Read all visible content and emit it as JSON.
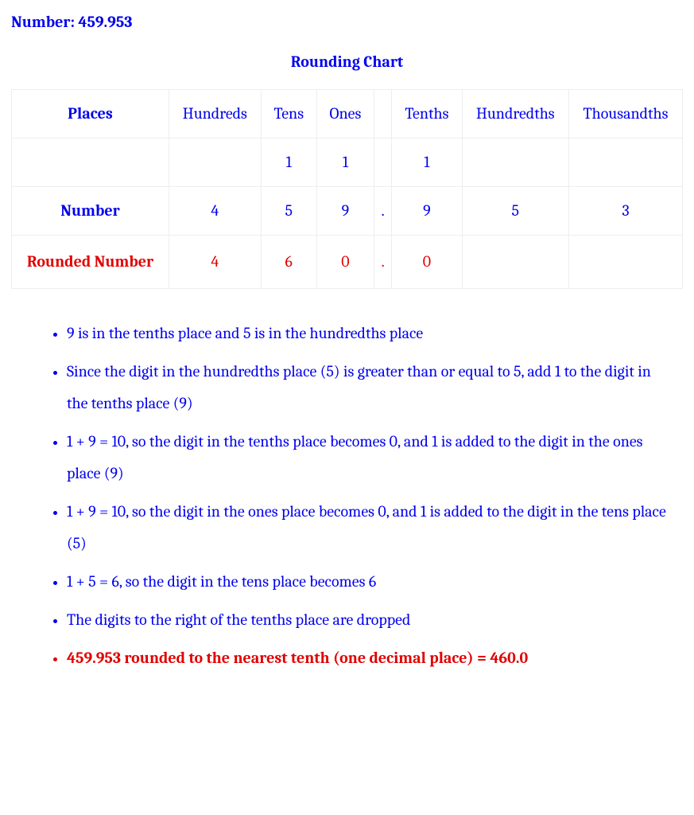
{
  "header": {
    "number_label": "Number: 459.953",
    "chart_title": "Rounding Chart"
  },
  "table": {
    "places_label": "Places",
    "cols": {
      "hundreds": "Hundreds",
      "tens": "Tens",
      "ones": "Ones",
      "tenths": "Tenths",
      "hundredths": "Hundredths",
      "thousandths": "Thousandths"
    },
    "carry": {
      "tens": "1",
      "ones": "1",
      "tenths": "1"
    },
    "number_label": "Number",
    "number": {
      "hundreds": "4",
      "tens": "5",
      "ones": "9",
      "dot": ".",
      "tenths": "9",
      "hundredths": "5",
      "thousandths": "3"
    },
    "rounded_label": "Rounded Number",
    "rounded": {
      "hundreds": "4",
      "tens": "6",
      "ones": "0",
      "dot": ".",
      "tenths": "0"
    }
  },
  "steps": {
    "s1": "9 is in the tenths place and 5 is in the hundredths place",
    "s2": "Since the digit in the hundredths place (5) is greater than or equal to 5, add 1 to the digit in the tenths place (9)",
    "s3": "1 + 9 = 10, so the digit in the tenths place becomes 0, and 1 is added to the digit in the ones place (9)",
    "s4": "1 + 9 = 10, so the digit in the ones place becomes 0, and 1 is added to the digit in the tens place (5)",
    "s5": "1 + 5 = 6, so the digit in the tens place becomes 6",
    "s6": "The digits to the right of the tenths place are dropped",
    "s7": "459.953 rounded to the nearest tenth (one decimal place) = 460.0"
  }
}
